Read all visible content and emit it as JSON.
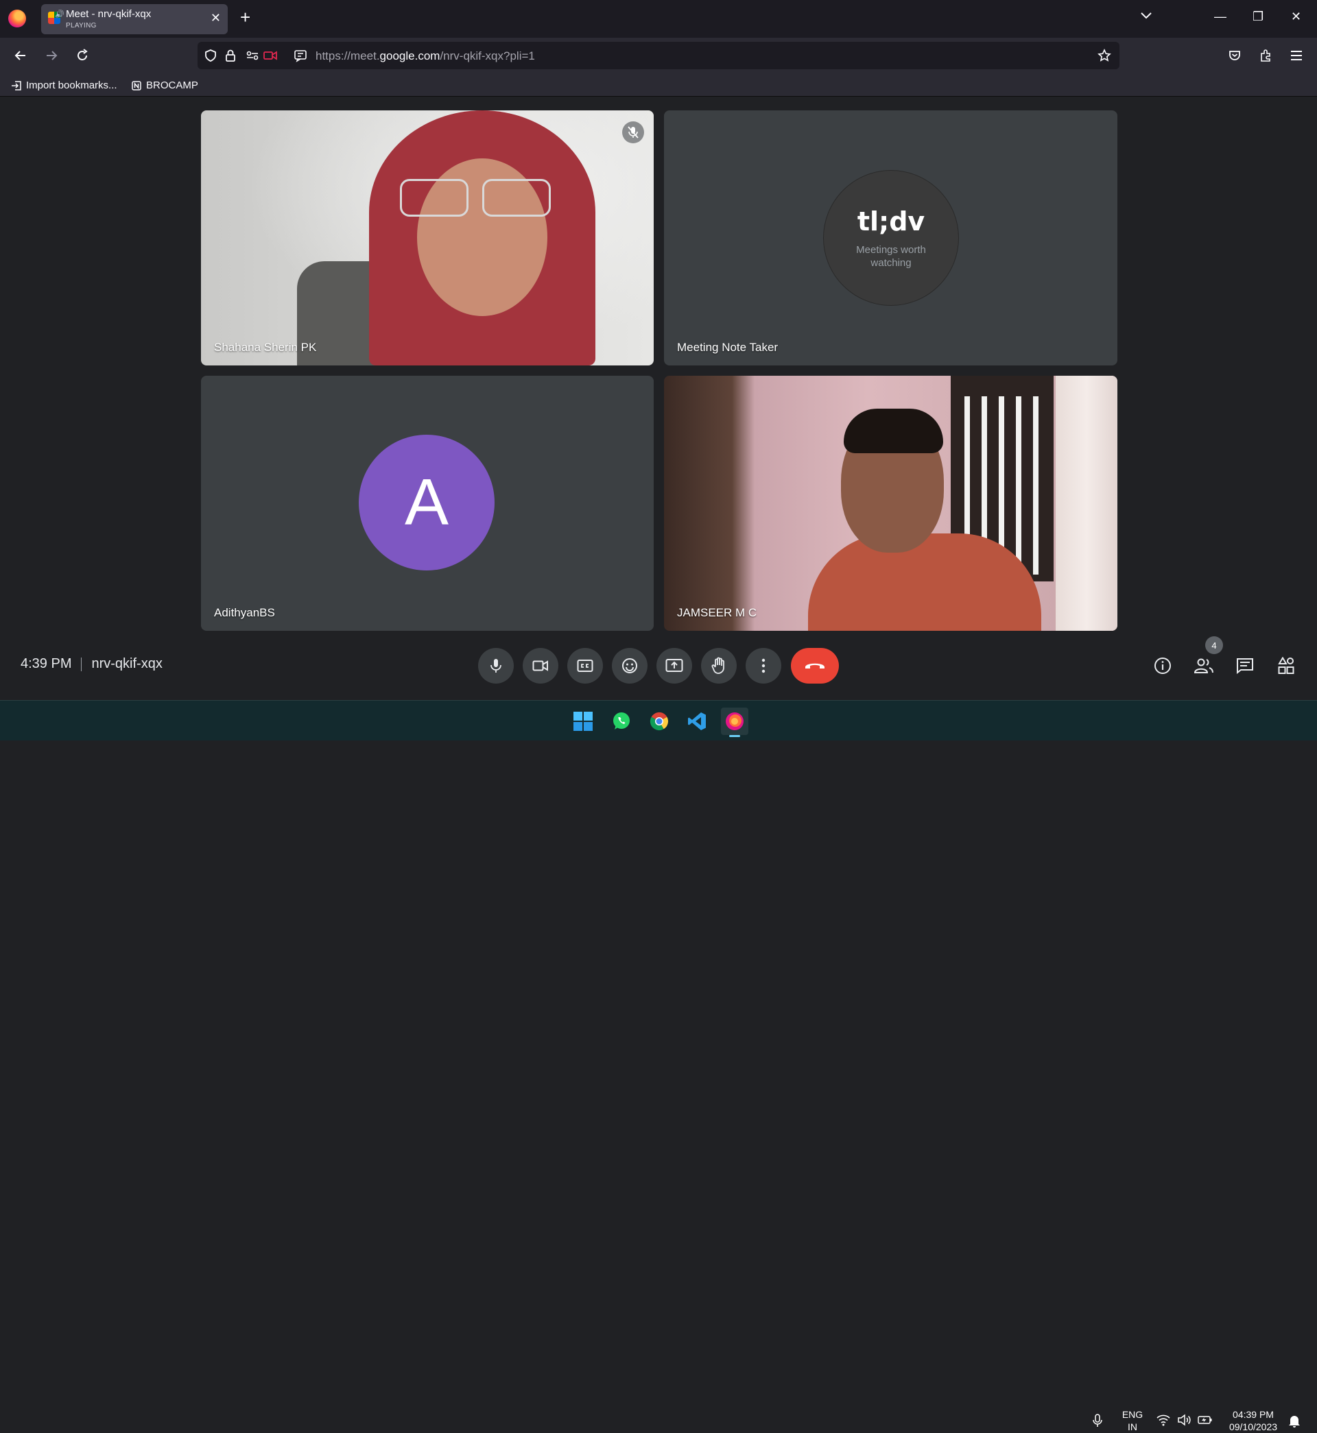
{
  "browser": {
    "tab": {
      "title": "Meet - nrv-qkif-xqx",
      "subtitle": "PLAYING"
    },
    "url": {
      "prefix": "https://meet.",
      "domain": "google.com",
      "path": "/nrv-qkif-xqx?pli=1"
    },
    "bookmarks": [
      {
        "label": "Import bookmarks..."
      },
      {
        "label": "BROCAMP"
      }
    ]
  },
  "meet": {
    "participants": [
      {
        "name": "Shahana Sherin PK",
        "muted": true
      },
      {
        "name": "Meeting Note Taker",
        "logo": "tl;dv",
        "tagline": "Meetings worth watching"
      },
      {
        "name": "AdithyanBS",
        "initial": "A",
        "avatar_color": "#7e57c2"
      },
      {
        "name": "JAMSEER M C"
      }
    ],
    "time": "4:39 PM",
    "meeting_code": "nrv-qkif-xqx",
    "people_count": "4",
    "end_call_color": "#ea4335"
  },
  "taskbar": {
    "language": {
      "line1": "ENG",
      "line2": "IN"
    },
    "clock": {
      "time": "04:39 PM",
      "date": "09/10/2023"
    }
  }
}
